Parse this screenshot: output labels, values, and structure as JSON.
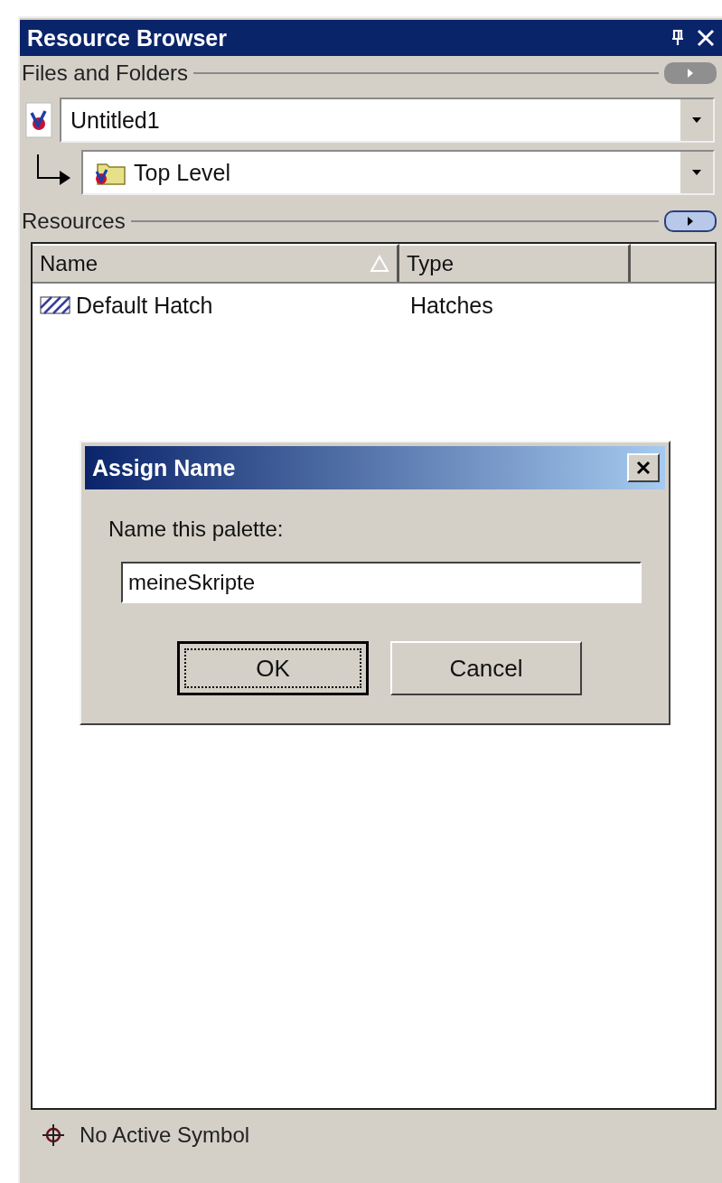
{
  "panel": {
    "title": "Resource Browser"
  },
  "files_section": {
    "label": "Files and Folders",
    "active": false,
    "file_combo": {
      "value": "Untitled1"
    },
    "folder_combo": {
      "value": "Top Level"
    }
  },
  "resources_section": {
    "label": "Resources",
    "active": true
  },
  "table": {
    "columns": [
      {
        "label": "Name",
        "sorted": true
      },
      {
        "label": "Type",
        "sorted": false
      }
    ],
    "rows": [
      {
        "name": "Default Hatch",
        "type": "Hatches"
      }
    ]
  },
  "dialog": {
    "title": "Assign Name",
    "label": "Name this palette:",
    "value": "meineSkripte",
    "buttons": [
      {
        "label": "OK",
        "default": true
      },
      {
        "label": "Cancel",
        "default": false
      }
    ]
  },
  "status_bar": {
    "text": "No Active Symbol"
  }
}
